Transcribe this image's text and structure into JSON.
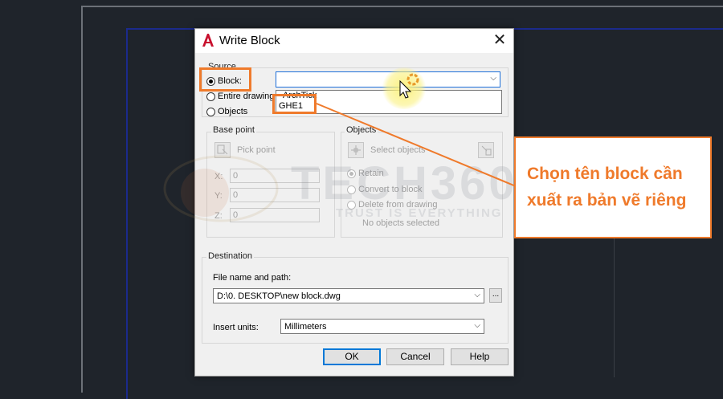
{
  "dialog": {
    "title": "Write Block",
    "source": {
      "label": "Source",
      "options": [
        "Block:",
        "Entire drawing",
        "Objects"
      ],
      "selected": "Block:",
      "block_value": "",
      "dropdown_items": [
        "ArchTick",
        "GHE1"
      ]
    },
    "base_point": {
      "label": "Base point",
      "pick_label": "Pick point",
      "x_label": "X:",
      "x_value": "0",
      "y_label": "Y:",
      "y_value": "0",
      "z_label": "Z:",
      "z_value": "0"
    },
    "objects": {
      "label": "Objects",
      "select_label": "Select objects",
      "options": [
        "Retain",
        "Convert to block",
        "Delete from drawing"
      ],
      "selected": "Retain",
      "status": "No objects selected"
    },
    "destination": {
      "label": "Destination",
      "file_label": "File name and path:",
      "file_value": "D:\\0. DESKTOP\\new block.dwg",
      "browse_label": "...",
      "units_label": "Insert units:",
      "units_value": "Millimeters"
    },
    "buttons": {
      "ok": "OK",
      "cancel": "Cancel",
      "help": "Help"
    }
  },
  "callout": {
    "text": "Chọn tên block cần xuất ra bản vẽ riêng"
  },
  "watermark": {
    "brand": "TECH360",
    "tagline": "TRUST IS EVERYTHING"
  },
  "colors": {
    "accent_orange": "#ef7a2b",
    "background": "#1f242b",
    "selection_blue": "#1e6fd9"
  }
}
